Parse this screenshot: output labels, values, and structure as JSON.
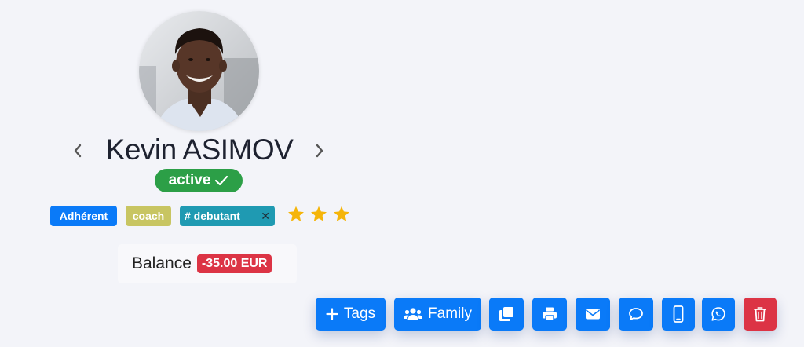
{
  "profile": {
    "first_name": "Kevin",
    "name": "Kevin ASIMOV",
    "status": "active",
    "tags": [
      {
        "label": "Adhérent",
        "color": "#0a7af8"
      },
      {
        "label": "coach",
        "color": "#c8c562"
      },
      {
        "label": "# debutant",
        "color": "#1f9ab2",
        "removable": true,
        "remove_symbol": "✕"
      }
    ],
    "rating": 3,
    "balance_label": "Balance",
    "balance_value": "-35.00 EUR"
  },
  "actions": {
    "tags_label": "Tags",
    "family_label": "Family"
  },
  "icons": [
    "chevron-left-icon",
    "chevron-right-icon",
    "checkmark-icon",
    "star-icon",
    "plus-icon",
    "users-icon",
    "copy-icon",
    "print-icon",
    "envelope-icon",
    "comment-icon",
    "mobile-icon",
    "whatsapp-icon",
    "trash-icon"
  ],
  "colors": {
    "primary": "#0a7af8",
    "success": "#2c9f47",
    "danger": "#dc3445",
    "star": "#f5b50a",
    "background": "#f3f4f9"
  }
}
